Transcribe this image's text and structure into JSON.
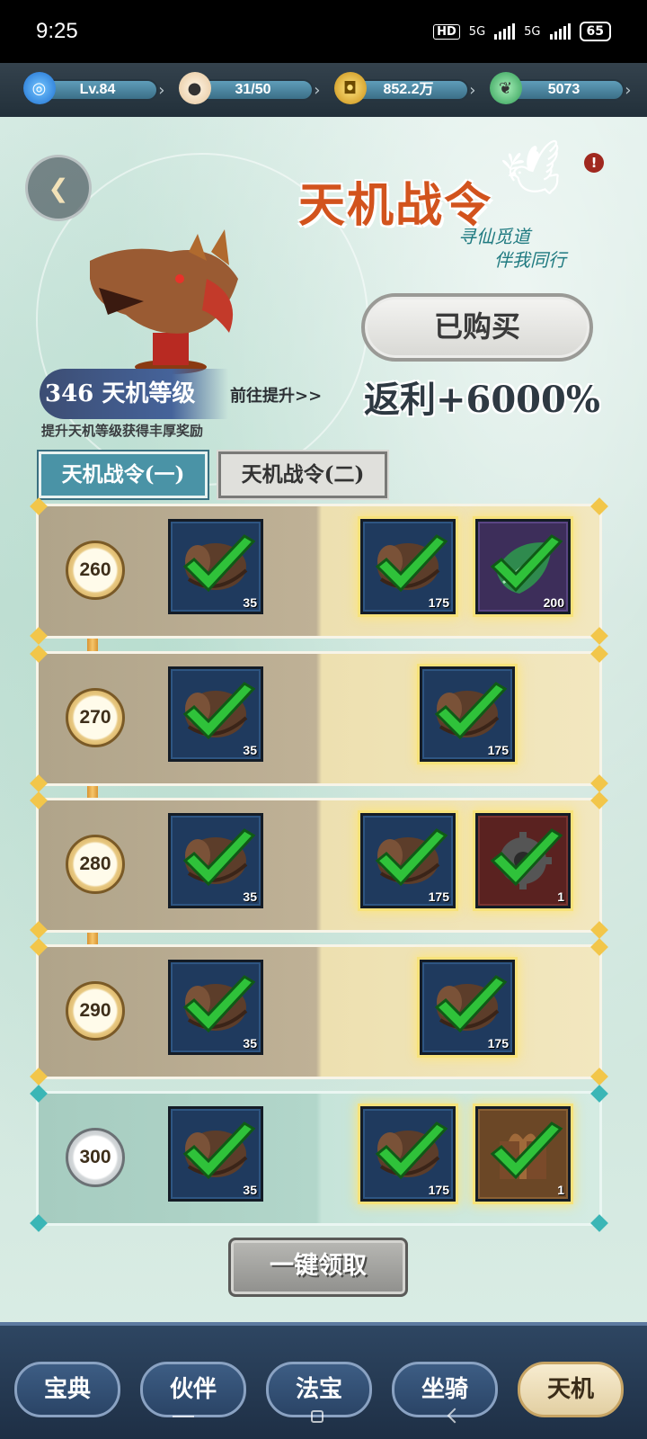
{
  "status_bar": {
    "time": "9:25",
    "hd": "HD",
    "sig1": "5G",
    "sig2": "5G",
    "battery": "65"
  },
  "resources": {
    "level": "Lv.84",
    "stamina": "31/50",
    "coins": "852.2万",
    "jade": "5073"
  },
  "header": {
    "title": "天机战令",
    "subtitle_line1": "寻仙觅道",
    "subtitle_line2": "伴我同行",
    "bought_label": "已购买",
    "rebate": "返利+6000%",
    "tianji_level": "346 天机等级",
    "goto_label": "前往提升>>",
    "hint": "提升天机等级获得丰厚奖励"
  },
  "tabs": [
    "天机战令(一)",
    "天机战令(二)"
  ],
  "rows": [
    {
      "level": "260",
      "free_qty": "35",
      "paid": [
        {
          "type": "wood",
          "qty": "175"
        },
        {
          "type": "leaf",
          "qty": "200"
        }
      ]
    },
    {
      "level": "270",
      "free_qty": "35",
      "paid": [
        {
          "type": "wood",
          "qty": "175"
        }
      ]
    },
    {
      "level": "280",
      "free_qty": "35",
      "paid": [
        {
          "type": "wood",
          "qty": "175"
        },
        {
          "type": "gear",
          "qty": "1"
        }
      ]
    },
    {
      "level": "290",
      "free_qty": "35",
      "paid": [
        {
          "type": "wood",
          "qty": "175"
        }
      ]
    },
    {
      "level": "300",
      "free_qty": "35",
      "paid": [
        {
          "type": "wood",
          "qty": "175"
        },
        {
          "type": "giftbox",
          "qty": "1"
        }
      ]
    }
  ],
  "claim_all": "一键领取",
  "bottom_nav": [
    "宝典",
    "伙伴",
    "法宝",
    "坐骑",
    "天机"
  ],
  "bottom_nav_active": "天机",
  "colors": {
    "title": "#d2531d",
    "check": "#2fc23a",
    "tab_active": "#4a93a6"
  }
}
